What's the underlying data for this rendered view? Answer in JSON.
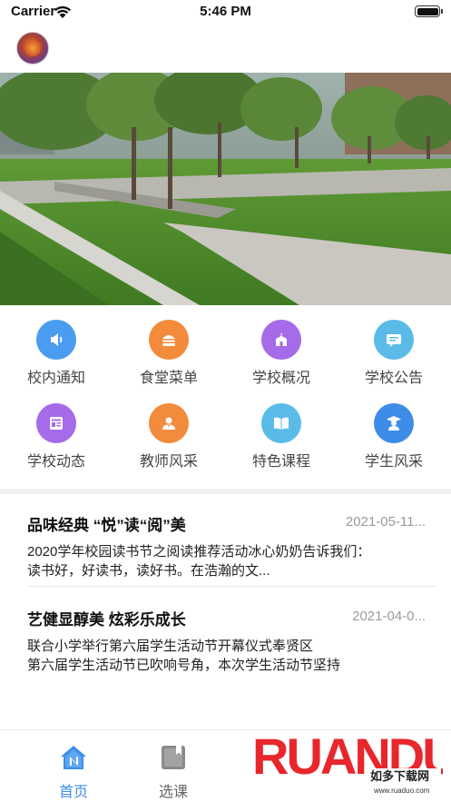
{
  "status_bar": {
    "carrier": "Carrier",
    "time": "5:46 PM"
  },
  "header": {
    "avatar": "user-avatar"
  },
  "banner": {
    "image": "campus-lawn-trees-photo"
  },
  "grid": {
    "items": [
      {
        "label": "校内通知",
        "icon": "speaker-icon",
        "color": "#4a9cf0"
      },
      {
        "label": "食堂菜单",
        "icon": "burger-icon",
        "color": "#f28b3c"
      },
      {
        "label": "学校概况",
        "icon": "school-building-icon",
        "color": "#a66be8"
      },
      {
        "label": "学校公告",
        "icon": "message-icon",
        "color": "#5bbbe8"
      },
      {
        "label": "学校动态",
        "icon": "news-icon",
        "color": "#a66be8"
      },
      {
        "label": "教师风采",
        "icon": "teacher-icon",
        "color": "#f28b3c"
      },
      {
        "label": "特色课程",
        "icon": "book-icon",
        "color": "#5bbbe8"
      },
      {
        "label": "学生风采",
        "icon": "graduate-icon",
        "color": "#3d8de8"
      }
    ]
  },
  "news": [
    {
      "title": "品味经典 “悦”读“阅”美",
      "date": "2021-05-11...",
      "summary_line1": "2020学年校园读书节之阅读推荐活动冰心奶奶告诉我们：",
      "summary_line2": "读书好，好读书，读好书。在浩瀚的文..."
    },
    {
      "title": "艺健显醇美 炫彩乐成长",
      "date": "2021-04-0...",
      "summary_line1": " 联合小学举行第六届学生活动节开幕仪式奉贤区",
      "summary_line2": "第六届学生活动节已吹响号角，本次学生活动节坚持"
    }
  ],
  "tab_bar": {
    "tabs": [
      {
        "label": "首页",
        "icon": "home-icon",
        "active": true,
        "color": "#3d8de8"
      },
      {
        "label": "选课",
        "icon": "course-select-icon",
        "active": false,
        "color": "#777777"
      }
    ]
  },
  "watermark": {
    "brand": "RUANDUO",
    "text": "如多下载网",
    "url": "www.ruaduo.com"
  }
}
